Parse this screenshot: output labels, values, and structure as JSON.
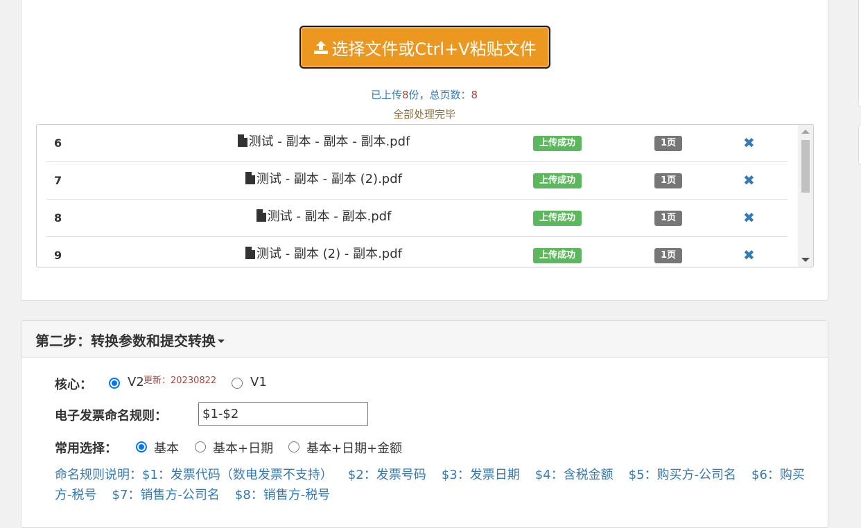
{
  "upload": {
    "button_label": "选择文件或Ctrl+V粘贴文件",
    "stats_prefix": "已上传",
    "uploaded_count": "8",
    "stats_mid": "份，总页数：",
    "total_pages": "8",
    "status": "全部处理完毕",
    "files": [
      {
        "index": "6",
        "name": "测试 - 副本 - 副本 - 副本.pdf",
        "status": "上传成功",
        "pages": "1页"
      },
      {
        "index": "7",
        "name": "测试 - 副本 - 副本 (2).pdf",
        "status": "上传成功",
        "pages": "1页"
      },
      {
        "index": "8",
        "name": "测试 - 副本 - 副本.pdf",
        "status": "上传成功",
        "pages": "1页"
      },
      {
        "index": "9",
        "name": "测试 - 副本 (2) - 副本.pdf",
        "status": "上传成功",
        "pages": "1页"
      }
    ],
    "delete_glyph": "✖"
  },
  "step2": {
    "title": "第二步：转换参数和提交转换",
    "core_label": "核心：",
    "core_v2": "V2",
    "core_v2_note": "更新：20230822",
    "core_v1": "V1",
    "naming_label": "电子发票命名规则：",
    "naming_value": "$1-$2",
    "common_label": "常用选择：",
    "common_options": [
      "基本",
      "基本+日期",
      "基本+日期+金额"
    ],
    "help_lines": [
      "命名规则说明：$1：发票代码（数电发票不支持）",
      "$2：发票号码",
      "$3：发票日期",
      "$4：含税金额",
      "$5：购买方-公司名",
      "$6：购买方-税号",
      "$7：销售方-公司名",
      "$8：销售方-税号"
    ]
  },
  "colors": {
    "upload_button": "#ec971f",
    "success_badge": "#5cb85c",
    "page_badge": "#777777",
    "link_blue": "#337ab7",
    "count_red": "#a94442",
    "status_brown": "#8a6d3b"
  },
  "icons": {
    "upload": "upload-icon",
    "file": "file-icon",
    "delete": "remove-icon"
  }
}
